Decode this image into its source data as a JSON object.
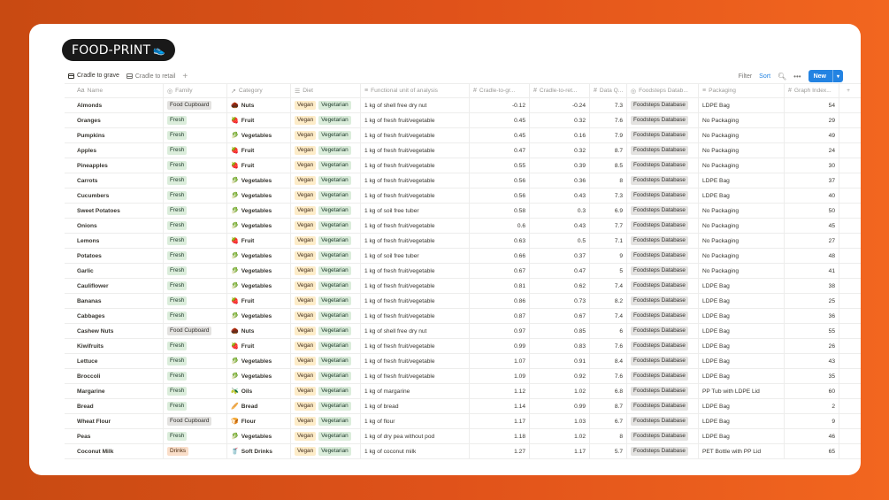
{
  "app": {
    "title": "FOOD-PRINT",
    "title_icon": "sneaker-icon"
  },
  "views": [
    {
      "label": "Cradle to grave",
      "active": true
    },
    {
      "label": "Cradle to retail",
      "active": false
    }
  ],
  "toolbar": {
    "filter": "Filter",
    "sort": "Sort",
    "new": "New"
  },
  "columns": {
    "name": "Name",
    "family": "Family",
    "category": "Category",
    "diet": "Diet",
    "functional_unit": "Functional unit of analysis",
    "cradle_grave": "Cradle-to-gr...",
    "cradle_retail": "Cradle-to-ret...",
    "data_quality": "Data Q...",
    "source": "Foodsteps Datab...",
    "packaging": "Packaging",
    "graph_index": "Graph Index..."
  },
  "colors": {
    "accent": "#2383e2",
    "background": "#e0521a"
  },
  "rows": [
    {
      "name": "Almonds",
      "family": "Food Cupboard",
      "category": "Nuts",
      "diet": [
        "Vegan",
        "Vegetarian"
      ],
      "fu": "1 kg of shell free dry nut",
      "cg": "-0.12",
      "cr": "-0.24",
      "dq": "7.3",
      "src": "Foodsteps Database",
      "pack": "LDPE Bag",
      "gi": "54"
    },
    {
      "name": "Oranges",
      "family": "Fresh",
      "category": "Fruit",
      "diet": [
        "Vegan",
        "Vegetarian"
      ],
      "fu": "1 kg of fresh fruit/vegetable",
      "cg": "0.45",
      "cr": "0.32",
      "dq": "7.6",
      "src": "Foodsteps Database",
      "pack": "No Packaging",
      "gi": "29"
    },
    {
      "name": "Pumpkins",
      "family": "Fresh",
      "category": "Vegetables",
      "diet": [
        "Vegan",
        "Vegetarian"
      ],
      "fu": "1 kg of fresh fruit/vegetable",
      "cg": "0.45",
      "cr": "0.16",
      "dq": "7.9",
      "src": "Foodsteps Database",
      "pack": "No Packaging",
      "gi": "49"
    },
    {
      "name": "Apples",
      "family": "Fresh",
      "category": "Fruit",
      "diet": [
        "Vegan",
        "Vegetarian"
      ],
      "fu": "1 kg of fresh fruit/vegetable",
      "cg": "0.47",
      "cr": "0.32",
      "dq": "8.7",
      "src": "Foodsteps Database",
      "pack": "No Packaging",
      "gi": "24"
    },
    {
      "name": "Pineapples",
      "family": "Fresh",
      "category": "Fruit",
      "diet": [
        "Vegan",
        "Vegetarian"
      ],
      "fu": "1 kg of fresh fruit/vegetable",
      "cg": "0.55",
      "cr": "0.39",
      "dq": "8.5",
      "src": "Foodsteps Database",
      "pack": "No Packaging",
      "gi": "30"
    },
    {
      "name": "Carrots",
      "family": "Fresh",
      "category": "Vegetables",
      "diet": [
        "Vegan",
        "Vegetarian"
      ],
      "fu": "1 kg of fresh fruit/vegetable",
      "cg": "0.56",
      "cr": "0.36",
      "dq": "8",
      "src": "Foodsteps Database",
      "pack": "LDPE Bag",
      "gi": "37"
    },
    {
      "name": "Cucumbers",
      "family": "Fresh",
      "category": "Vegetables",
      "diet": [
        "Vegan",
        "Vegetarian"
      ],
      "fu": "1 kg of fresh fruit/vegetable",
      "cg": "0.56",
      "cr": "0.43",
      "dq": "7.3",
      "src": "Foodsteps Database",
      "pack": "LDPE Bag",
      "gi": "40"
    },
    {
      "name": "Sweet Potatoes",
      "family": "Fresh",
      "category": "Vegetables",
      "diet": [
        "Vegan",
        "Vegetarian"
      ],
      "fu": "1 kg of soil free tuber",
      "cg": "0.58",
      "cr": "0.3",
      "dq": "6.9",
      "src": "Foodsteps Database",
      "pack": "No Packaging",
      "gi": "50"
    },
    {
      "name": "Onions",
      "family": "Fresh",
      "category": "Vegetables",
      "diet": [
        "Vegan",
        "Vegetarian"
      ],
      "fu": "1 kg of fresh fruit/vegetable",
      "cg": "0.6",
      "cr": "0.43",
      "dq": "7.7",
      "src": "Foodsteps Database",
      "pack": "No Packaging",
      "gi": "45"
    },
    {
      "name": "Lemons",
      "family": "Fresh",
      "category": "Fruit",
      "diet": [
        "Vegan",
        "Vegetarian"
      ],
      "fu": "1 kg of fresh fruit/vegetable",
      "cg": "0.63",
      "cr": "0.5",
      "dq": "7.1",
      "src": "Foodsteps Database",
      "pack": "No Packaging",
      "gi": "27"
    },
    {
      "name": "Potatoes",
      "family": "Fresh",
      "category": "Vegetables",
      "diet": [
        "Vegan",
        "Vegetarian"
      ],
      "fu": "1 kg of soil free tuber",
      "cg": "0.66",
      "cr": "0.37",
      "dq": "9",
      "src": "Foodsteps Database",
      "pack": "No Packaging",
      "gi": "48"
    },
    {
      "name": "Garlic",
      "family": "Fresh",
      "category": "Vegetables",
      "diet": [
        "Vegan",
        "Vegetarian"
      ],
      "fu": "1 kg of fresh fruit/vegetable",
      "cg": "0.67",
      "cr": "0.47",
      "dq": "5",
      "src": "Foodsteps Database",
      "pack": "No Packaging",
      "gi": "41"
    },
    {
      "name": "Cauliflower",
      "family": "Fresh",
      "category": "Vegetables",
      "diet": [
        "Vegan",
        "Vegetarian"
      ],
      "fu": "1 kg of fresh fruit/vegetable",
      "cg": "0.81",
      "cr": "0.62",
      "dq": "7.4",
      "src": "Foodsteps Database",
      "pack": "LDPE Bag",
      "gi": "38"
    },
    {
      "name": "Bananas",
      "family": "Fresh",
      "category": "Fruit",
      "diet": [
        "Vegan",
        "Vegetarian"
      ],
      "fu": "1 kg of fresh fruit/vegetable",
      "cg": "0.86",
      "cr": "0.73",
      "dq": "8.2",
      "src": "Foodsteps Database",
      "pack": "LDPE Bag",
      "gi": "25"
    },
    {
      "name": "Cabbages",
      "family": "Fresh",
      "category": "Vegetables",
      "diet": [
        "Vegan",
        "Vegetarian"
      ],
      "fu": "1 kg of fresh fruit/vegetable",
      "cg": "0.87",
      "cr": "0.67",
      "dq": "7.4",
      "src": "Foodsteps Database",
      "pack": "LDPE Bag",
      "gi": "36"
    },
    {
      "name": "Cashew Nuts",
      "family": "Food Cupboard",
      "category": "Nuts",
      "diet": [
        "Vegan",
        "Vegetarian"
      ],
      "fu": "1 kg of shell free dry nut",
      "cg": "0.97",
      "cr": "0.85",
      "dq": "6",
      "src": "Foodsteps Database",
      "pack": "LDPE Bag",
      "gi": "55"
    },
    {
      "name": "Kiwifruits",
      "family": "Fresh",
      "category": "Fruit",
      "diet": [
        "Vegan",
        "Vegetarian"
      ],
      "fu": "1 kg of fresh fruit/vegetable",
      "cg": "0.99",
      "cr": "0.83",
      "dq": "7.6",
      "src": "Foodsteps Database",
      "pack": "LDPE Bag",
      "gi": "26"
    },
    {
      "name": "Lettuce",
      "family": "Fresh",
      "category": "Vegetables",
      "diet": [
        "Vegan",
        "Vegetarian"
      ],
      "fu": "1 kg of fresh fruit/vegetable",
      "cg": "1.07",
      "cr": "0.91",
      "dq": "8.4",
      "src": "Foodsteps Database",
      "pack": "LDPE Bag",
      "gi": "43"
    },
    {
      "name": "Broccoli",
      "family": "Fresh",
      "category": "Vegetables",
      "diet": [
        "Vegan",
        "Vegetarian"
      ],
      "fu": "1 kg of fresh fruit/vegetable",
      "cg": "1.09",
      "cr": "0.92",
      "dq": "7.6",
      "src": "Foodsteps Database",
      "pack": "LDPE Bag",
      "gi": "35"
    },
    {
      "name": "Margarine",
      "family": "Fresh",
      "category": "Oils",
      "diet": [
        "Vegan",
        "Vegetarian"
      ],
      "fu": "1 kg of margarine",
      "cg": "1.12",
      "cr": "1.02",
      "dq": "6.8",
      "src": "Foodsteps Database",
      "pack": "PP Tub with LDPE Lid",
      "gi": "60"
    },
    {
      "name": "Bread",
      "family": "Fresh",
      "category": "Bread",
      "diet": [
        "Vegan",
        "Vegetarian"
      ],
      "fu": "1 kg of bread",
      "cg": "1.14",
      "cr": "0.99",
      "dq": "8.7",
      "src": "Foodsteps Database",
      "pack": "LDPE Bag",
      "gi": "2"
    },
    {
      "name": "Wheat Flour",
      "family": "Food Cupboard",
      "category": "Flour",
      "diet": [
        "Vegan",
        "Vegetarian"
      ],
      "fu": "1 kg of flour",
      "cg": "1.17",
      "cr": "1.03",
      "dq": "6.7",
      "src": "Foodsteps Database",
      "pack": "LDPE Bag",
      "gi": "9"
    },
    {
      "name": "Peas",
      "family": "Fresh",
      "category": "Vegetables",
      "diet": [
        "Vegan",
        "Vegetarian"
      ],
      "fu": "1 kg of dry pea without pod",
      "cg": "1.18",
      "cr": "1.02",
      "dq": "8",
      "src": "Foodsteps Database",
      "pack": "LDPE Bag",
      "gi": "46"
    },
    {
      "name": "Coconut Milk",
      "family": "Drinks",
      "category": "Soft Drinks",
      "diet": [
        "Vegan",
        "Vegetarian"
      ],
      "fu": "1 kg of coconut milk",
      "cg": "1.27",
      "cr": "1.17",
      "dq": "5.7",
      "src": "Foodsteps Database",
      "pack": "PET Bottle with PP Lid",
      "gi": "65"
    }
  ]
}
